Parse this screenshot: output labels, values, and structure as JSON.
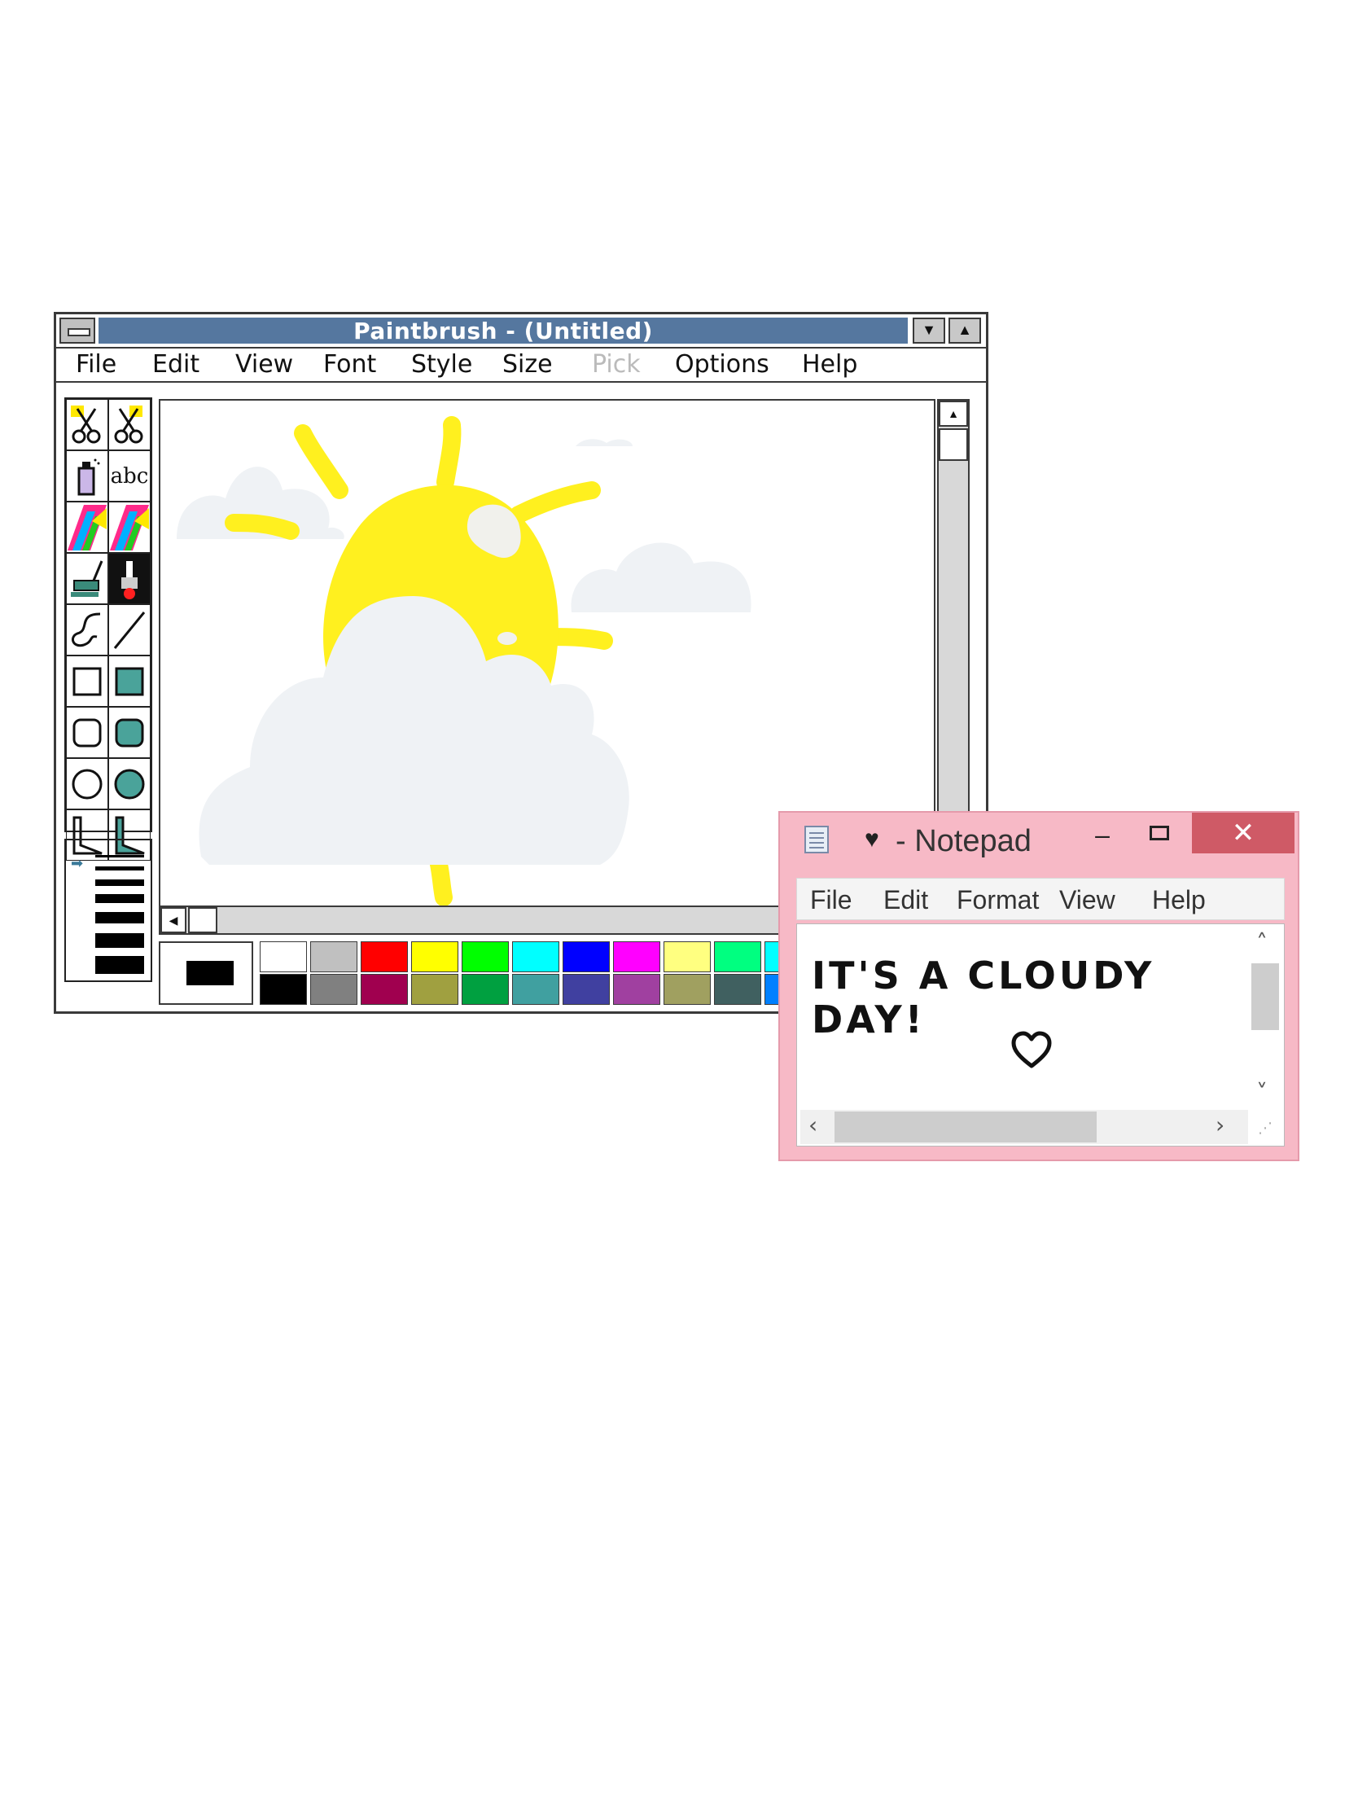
{
  "paintbrush": {
    "title": "Paintbrush - (Untitled)",
    "menu": [
      {
        "label": "File"
      },
      {
        "label": "Edit"
      },
      {
        "label": "View"
      },
      {
        "label": "Font"
      },
      {
        "label": "Style"
      },
      {
        "label": "Size"
      },
      {
        "label": "Pick",
        "disabled": true
      },
      {
        "label": "Options"
      },
      {
        "label": "Help"
      }
    ],
    "tools": [
      "scissors-icon",
      "pick-scissors-icon",
      "airbrush-icon",
      "text-tool-icon",
      "color-eraser-icon",
      "eraser-icon",
      "paint-roller-icon",
      "brush-icon",
      "curve-icon",
      "line-icon",
      "box-icon",
      "filled-box-icon",
      "rounded-box-icon",
      "filled-rounded-box-icon",
      "circle-icon",
      "filled-circle-icon",
      "polygon-icon",
      "filled-polygon-icon"
    ],
    "text_tool_label": "abc",
    "palette_top": [
      "#ffffff",
      "#c0c0c0",
      "#ff0000",
      "#ffff00",
      "#00ff00",
      "#00ffff",
      "#0000ff",
      "#ff00ff",
      "#ffff80",
      "#00ff80",
      "#00ffff"
    ],
    "palette_bottom": [
      "#000000",
      "#808080",
      "#a0004f",
      "#a0a040",
      "#00a040",
      "#40a0a0",
      "#4040a0",
      "#a040a0",
      "#a0a060",
      "#406060",
      "#0080ff"
    ],
    "current_color": "#000000",
    "colors": {
      "title_bar": "#55779f",
      "sun": "#fff01f",
      "cloud": "#eff2f5"
    }
  },
  "notepad": {
    "title": "- Notepad",
    "heart_symbol": "♥",
    "menu": [
      "File",
      "Edit",
      "Format",
      "View",
      "Help"
    ],
    "content": "IT'S A CLOUDY DAY!",
    "controls": {
      "minimize": "–",
      "close": "✕"
    },
    "colors": {
      "frame": "#f7b9c6",
      "close_button": "#cf5a66"
    }
  }
}
